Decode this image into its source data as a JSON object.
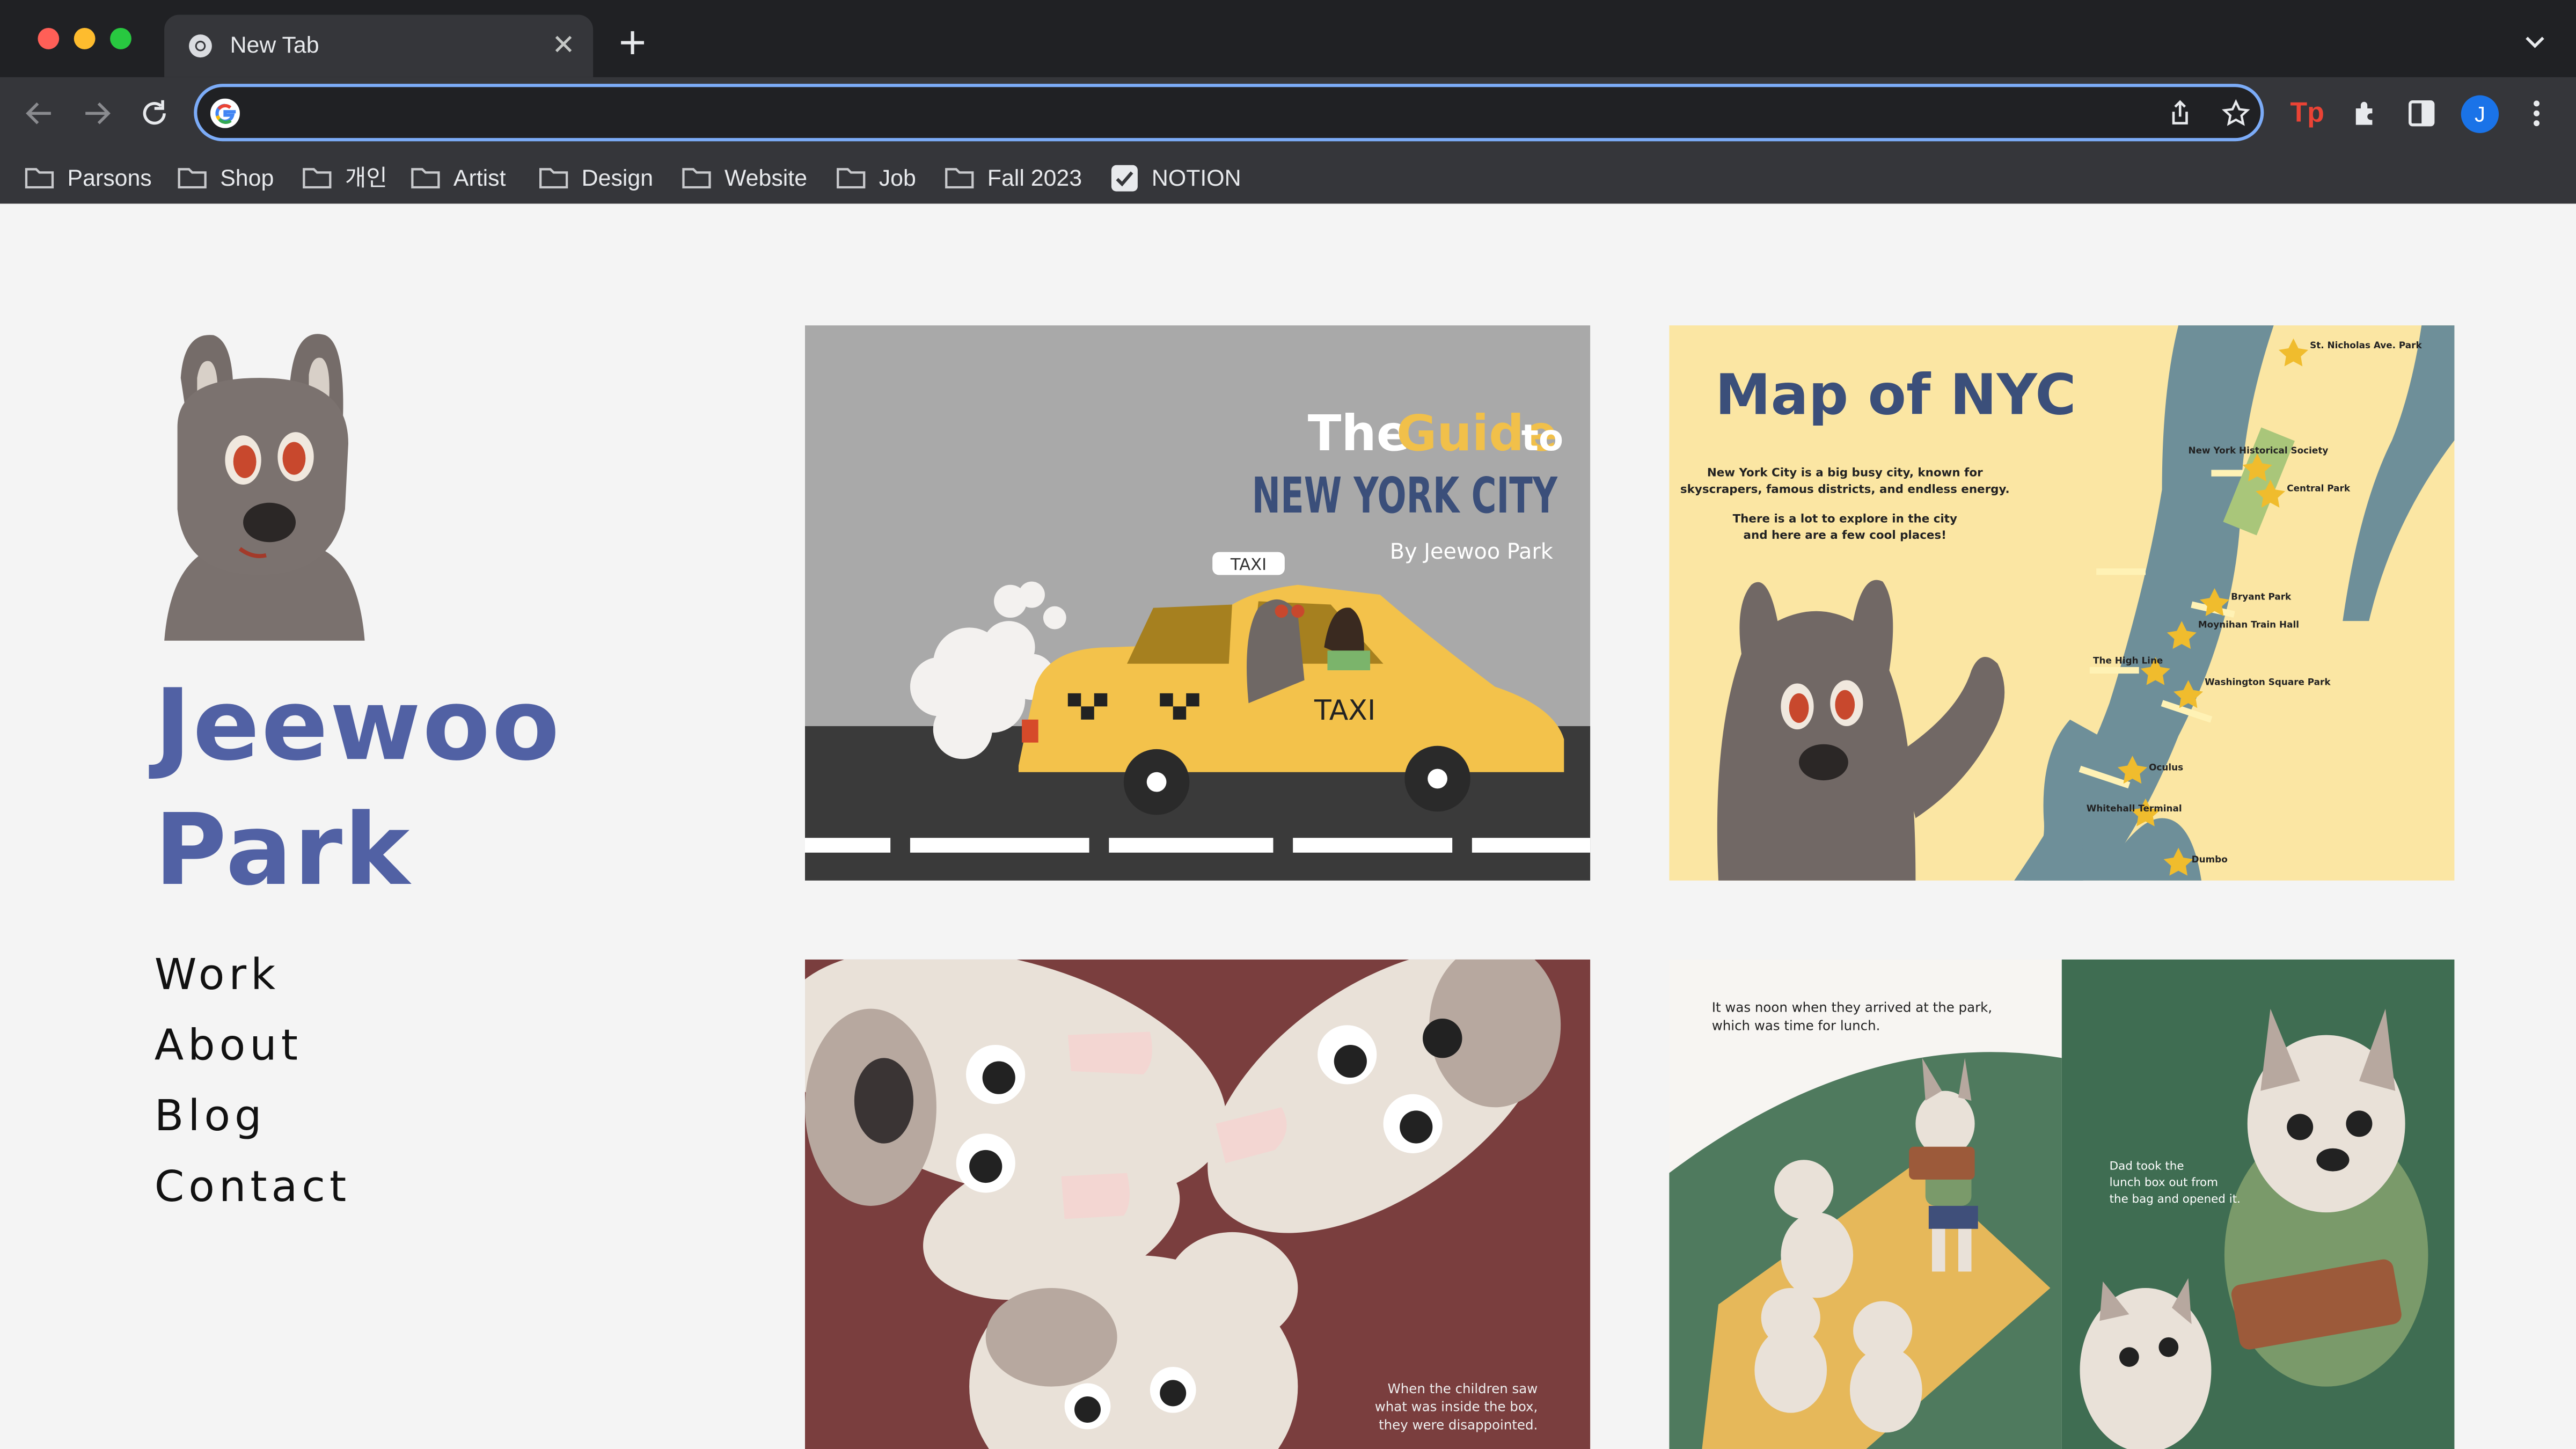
{
  "browser": {
    "tab_title": "New Tab",
    "address_placeholder": "",
    "profile_initial": "J",
    "bookmarks": [
      "Parsons",
      "Shop",
      "개인",
      "Artist",
      "Design",
      "Website",
      "Job",
      "Fall 2023",
      "NOTION"
    ],
    "extension_label": "Tp",
    "colors": {
      "tabstrip": "#202124",
      "toolbar": "#35363a",
      "focus_ring": "#7cacf8",
      "avatar": "#1a73e8"
    }
  },
  "site": {
    "name_line1": "Jeewoo",
    "name_line2": "Park",
    "nav": [
      "Work",
      "About",
      "Blog",
      "Contact"
    ],
    "accent_color": "#5161a4"
  },
  "works": {
    "guide": {
      "title_the": "The",
      "title_guide": "Guide",
      "title_to": "to",
      "title_city": "NEW YORK CITY",
      "byline": "By Jeewoo Park",
      "taxi_sign": "TAXI",
      "taxi_door": "TAXI"
    },
    "map": {
      "title": "Map of NYC",
      "intro_1": "New York City is a big busy city, known for",
      "intro_2": "skyscrapers, famous districts, and endless energy.",
      "intro_3": "There is a lot to explore in the city",
      "intro_4": "and here are a few cool places!",
      "places": [
        "St. Nicholas Ave. Park",
        "New York Historical Society",
        "Central Park",
        "Bryant Park",
        "Moynihan Train Hall",
        "The High Line",
        "Washington Square Park",
        "Oculus",
        "Whitehall Terminal",
        "Dumbo"
      ]
    },
    "faces": {
      "caption_1": "When the children saw",
      "caption_2": "what was inside the box,",
      "caption_3": "they were disappointed."
    },
    "picnic": {
      "left_1": "It was noon when they arrived at the park,",
      "left_2": "which was time for lunch.",
      "right_1": "Dad took the",
      "right_2": "lunch box out from",
      "right_3": "the bag and opened it."
    }
  }
}
